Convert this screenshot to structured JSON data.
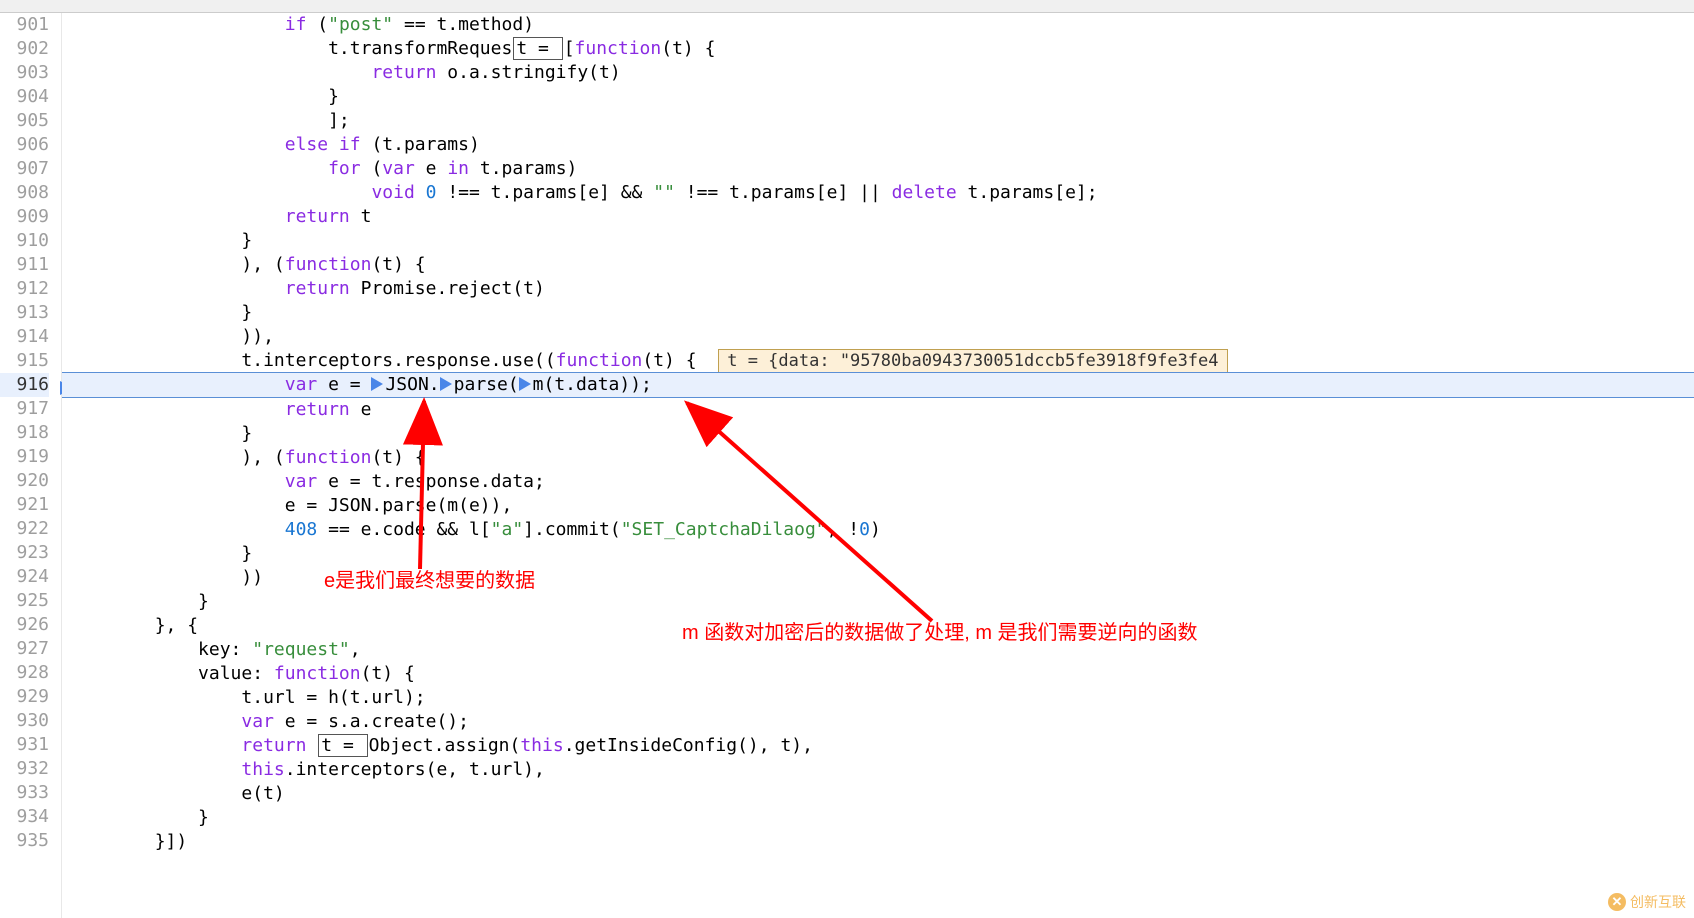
{
  "lines": {
    "start": 901,
    "end": 935,
    "current": 916
  },
  "code": {
    "l901": "                    if (\"post\" == t.method)",
    "l902": "                        t.transformRequest = [function(t) {",
    "l903": "                            return o.a.stringify(t)",
    "l904": "                        }",
    "l905": "                        ];",
    "l906": "                    else if (t.params)",
    "l907": "                        for (var e in t.params)",
    "l908": "                            void 0 !== t.params[e] && \"\" !== t.params[e] || delete t.params[e];",
    "l909": "                    return t",
    "l910": "                }",
    "l911": "                ), (function(t) {",
    "l912": "                    return Promise.reject(t)",
    "l913": "                }",
    "l914": "                )),",
    "l915": "                t.interceptors.response.use((function(t) {",
    "l916": "                    var e = JSON.parse(m(t.data));",
    "l917": "                    return e",
    "l918": "                }",
    "l919": "                ), (function(t) {",
    "l920": "                    var e = t.response.data;",
    "l921": "                    e = JSON.parse(m(e)),",
    "l922": "                    408 == e.code && l[\"a\"].commit(\"SET_CaptchaDilaog\", !0)",
    "l923": "                }",
    "l924": "                ))",
    "l925": "            }",
    "l926": "        }, {",
    "l927": "            key: \"request\",",
    "l928": "            value: function(t) {",
    "l929": "                t.url = h(t.url);",
    "l930": "                var e = s.a.create();",
    "l931": "                return t = Object.assign(this.getInsideConfig(), t),",
    "l932": "                this.interceptors(e, t.url),",
    "l933": "                e(t)",
    "l934": "            }",
    "l935": "        }])"
  },
  "tooltip": {
    "text": "t = {data: \"95780ba0943730051dccb5fe3918f9fe3fe4"
  },
  "annotations": {
    "left": "e是我们最终想要的数据",
    "right": "m 函数对加密后的数据做了处理, m 是我们需要逆向的函数"
  },
  "watermark": {
    "text": "创新互联"
  }
}
